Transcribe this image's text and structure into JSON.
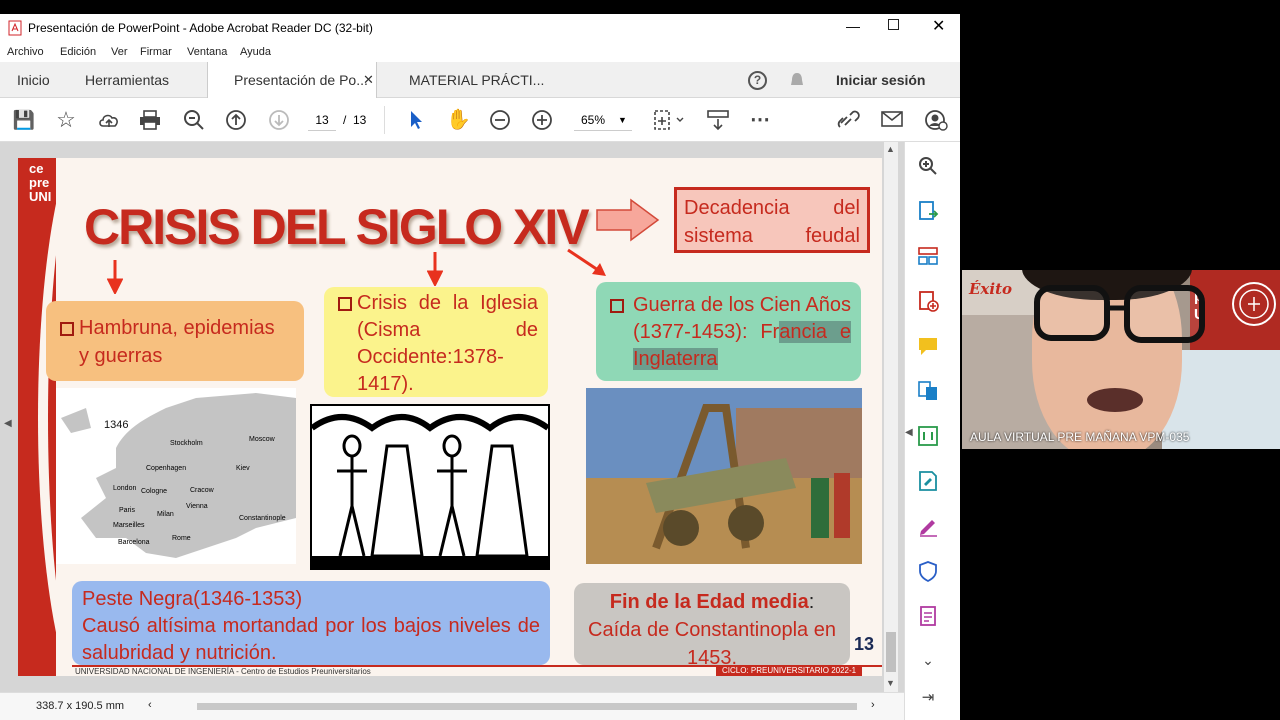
{
  "window": {
    "title": "Presentación de PowerPoint - Adobe Acrobat Reader DC (32-bit)"
  },
  "menu": [
    "Archivo",
    "Edición",
    "Ver",
    "Firmar",
    "Ventana",
    "Ayuda"
  ],
  "tabs": {
    "home": "Inicio",
    "tools": "Herramientas",
    "doc1": "Presentación de Po...",
    "doc2": "MATERIAL PRÁCTI...",
    "signin": "Iniciar sesión"
  },
  "toolbar": {
    "page_current": "13",
    "page_sep": "/",
    "page_total": "13",
    "zoom": "65%"
  },
  "status": {
    "dimensions": "338.7 x 190.5 mm"
  },
  "slide": {
    "logo": [
      "ce",
      "pre",
      "UNI"
    ],
    "title": "CRISIS DEL SIGLO XIV",
    "decadencia": "Decadencia del sistema feudal",
    "box1": "Hambruna, epidemias y guerras",
    "box2": "Crisis de la Iglesia (Cisma de Occidente:1378-1417).",
    "box3_a": "Guerra de los Cien Años (1377-1453): Fr",
    "box3_b": "ancia e Inglaterra",
    "map_year": "1346",
    "map_labels": [
      "Moscow",
      "Stockholm",
      "Copenhagen",
      "Kiev",
      "London",
      "Cologne",
      "Cracow",
      "Paris",
      "Vienna",
      "Milan",
      "Marseilles",
      "Constantinople",
      "Rome",
      "Barcelona"
    ],
    "peste_title": "Peste Negra(1346-1353)",
    "peste_body": "Causó altísima mortandad por los bajos niveles de salubridad y nutrición.",
    "fin_bold": "Fin de la Edad media",
    "fin_colon": ":",
    "fin_body": "Caída de Constantinopla en 1453.",
    "page_num": "13",
    "footer_left": "UNIVERSIDAD NACIONAL DE INGENIERÍA - Centro de Estudios Preuniversitarios",
    "footer_right": "CICLO: PREUNIVERSITARIO 2022-1"
  },
  "webcam": {
    "label": "AULA VIRTUAL PRE MAÑANA VPM-035",
    "sign": "Éxito",
    "logo_letters": "p\nU"
  },
  "colors": {
    "accent": "#c62a1e",
    "box1": "#f7c07f",
    "box2": "#fbf38c",
    "box3": "#8fd8b6",
    "peste": "#99b9ee",
    "fin": "#c9c6c2"
  }
}
